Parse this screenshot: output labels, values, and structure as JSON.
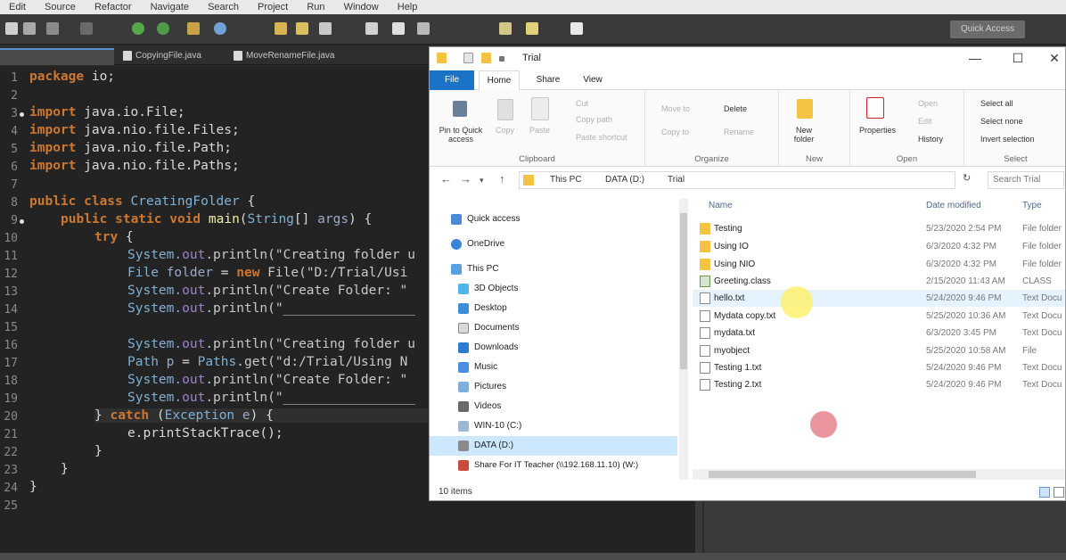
{
  "ide": {
    "menu": [
      "Edit",
      "Source",
      "Refactor",
      "Navigate",
      "Search",
      "Project",
      "Run",
      "Window",
      "Help"
    ],
    "quick_access": "Quick Access",
    "tabs": [
      "CopyingFile.java",
      "MoveRenameFile.java"
    ],
    "line_numbers": [
      "1",
      "2",
      "3",
      "4",
      "5",
      "6",
      "7",
      "8",
      "9",
      "10",
      "11",
      "12",
      "13",
      "14",
      "15",
      "16",
      "17",
      "18",
      "19",
      "20",
      "21",
      "22",
      "23",
      "24",
      "25"
    ],
    "code": {
      "l1_kw": "package",
      "l1_rest": " io;",
      "l3_kw": "import",
      "l3_rest": " java.io.File;",
      "l4_kw": "import",
      "l4_rest": " java.nio.file.Files;",
      "l5_kw": "import",
      "l5_rest": " java.nio.file.Path;",
      "l6_kw": "import",
      "l6_rest": " java.nio.file.Paths;",
      "l8_kw": "public class",
      "l8_cls": "CreatingFolder",
      "l8_rest": " {",
      "l9_kw": "public static void",
      "l9_fn": "main",
      "l9_rest1": "(",
      "l9_cls": "String",
      "l9_rest2": "[] ",
      "l9_var": "args",
      "l9_rest3": ") {",
      "l10_kw": "try",
      "l10_rest": " {",
      "l11_a": "System.",
      "l11_b": "out",
      "l11_c": ".println(\"Creating folder u",
      "l12_a": "File",
      "l12_b": " folder",
      "l12_c": " = ",
      "l12_d": "new",
      "l12_e": " File(\"D:/Trial/Usi",
      "l13_a": "System.",
      "l13_b": "out",
      "l13_c": ".println(\"Create Folder: \"",
      "l14_a": "System.",
      "l14_b": "out",
      "l14_c": ".println(\"_________________",
      "l16_a": "System.",
      "l16_b": "out",
      "l16_c": ".println(\"Creating folder u",
      "l17_a": "Path",
      "l17_b": " p",
      "l17_c": " = ",
      "l17_d": "Paths",
      "l17_e": ".get(\"d:/Trial/Using N",
      "l18_a": "System.",
      "l18_b": "out",
      "l18_c": ".println(\"Create Folder: \"",
      "l19_a": "System.",
      "l19_b": "out",
      "l19_c": ".println(\"_________________",
      "l20_a": "} ",
      "l20_b": "catch",
      "l20_c": " (",
      "l20_d": "Exception",
      "l20_e": " e",
      "l20_f": ") {",
      "l21": "e.printStackTrace();",
      "l22": "}",
      "l23": "}",
      "l24": "}"
    }
  },
  "explorer": {
    "title_path": "Trial",
    "window_controls": [
      "—",
      "☐",
      "✕"
    ],
    "ribbon_tabs": [
      "File",
      "Home",
      "Share",
      "View"
    ],
    "clipboard": {
      "pin": "Pin to Quick access",
      "copy": "Copy",
      "paste": "Paste",
      "cut": "Cut",
      "copy_path": "Copy path",
      "paste_shortcut": "Paste shortcut",
      "label": "Clipboard"
    },
    "organize": {
      "move_to": "Move to",
      "copy_to": "Copy to",
      "delete": "Delete",
      "rename": "Rename",
      "label": "Organize"
    },
    "new": {
      "new_folder": "New folder",
      "label": "New"
    },
    "open": {
      "properties": "Properties",
      "open": "Open",
      "edit": "Edit",
      "history": "History",
      "label": "Open"
    },
    "select": {
      "select_all": "Select all",
      "select_none": "Select none",
      "invert": "Invert selection",
      "label": "Select"
    },
    "address": [
      "This PC",
      "DATA (D:)",
      "Trial"
    ],
    "search_placeholder": "Search Trial",
    "nav": [
      "Quick access",
      "OneDrive",
      "This PC",
      "3D Objects",
      "Desktop",
      "Documents",
      "Downloads",
      "Music",
      "Pictures",
      "Videos",
      "WIN-10 (C:)",
      "DATA (D:)",
      "Share For IT Teacher (\\\\192.168.11.10) (W:)"
    ],
    "columns": {
      "name": "Name",
      "date": "Date modified",
      "type": "Type"
    },
    "files": [
      {
        "name": "Testing",
        "date": "5/23/2020 2:54 PM",
        "type": "File folder",
        "kind": "folder"
      },
      {
        "name": "Using IO",
        "date": "6/3/2020 4:32 PM",
        "type": "File folder",
        "kind": "folder"
      },
      {
        "name": "Using NIO",
        "date": "6/3/2020 4:32 PM",
        "type": "File folder",
        "kind": "folder"
      },
      {
        "name": "Greeting.class",
        "date": "2/15/2020 11:43 AM",
        "type": "CLASS File",
        "kind": "doc"
      },
      {
        "name": "hello.txt",
        "date": "5/24/2020 9:46 PM",
        "type": "Text Docu",
        "kind": "doc"
      },
      {
        "name": "Mydata copy.txt",
        "date": "5/25/2020 10:36 AM",
        "type": "Text Docu",
        "kind": "doc"
      },
      {
        "name": "mydata.txt",
        "date": "6/3/2020 3:45 PM",
        "type": "Text Docu",
        "kind": "doc"
      },
      {
        "name": "myobject",
        "date": "5/25/2020 10:58 AM",
        "type": "File",
        "kind": "doc"
      },
      {
        "name": "Testing 1.txt",
        "date": "5/24/2020 9:46 PM",
        "type": "Text Docu",
        "kind": "doc"
      },
      {
        "name": "Testing 2.txt",
        "date": "5/24/2020 9:46 PM",
        "type": "Text Docu",
        "kind": "doc"
      }
    ],
    "status": "10 items",
    "colors": {
      "accent": "#1a73c7",
      "folder": "#f5c344",
      "selection": "#cce8ff"
    }
  }
}
